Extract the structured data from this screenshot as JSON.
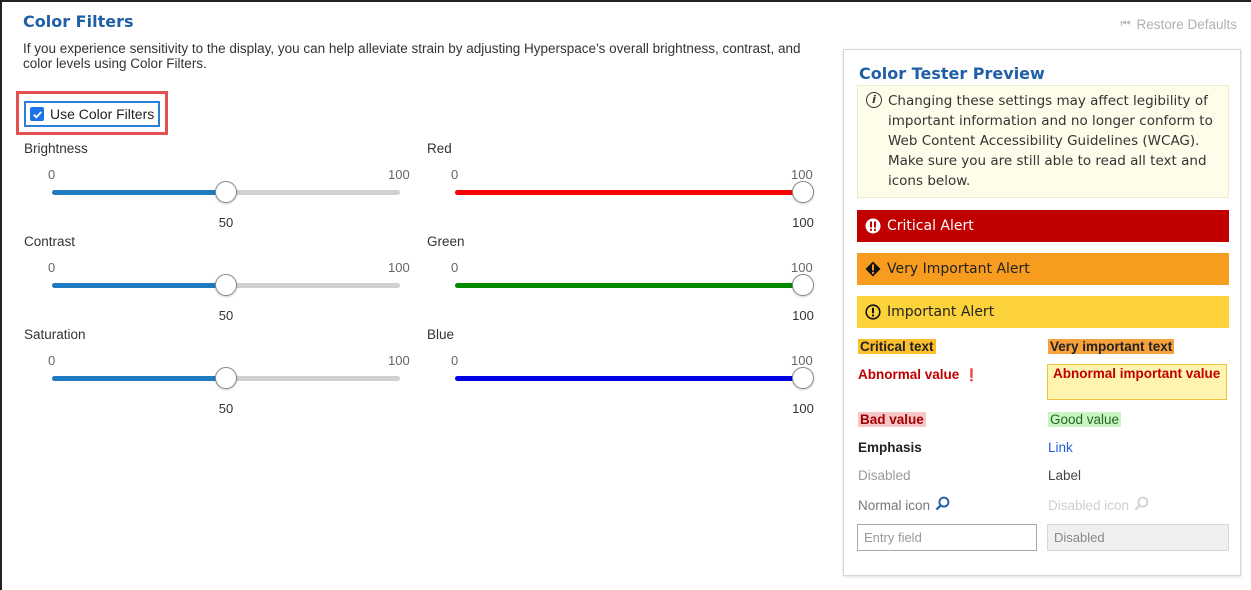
{
  "header": {
    "title": "Color Filters",
    "restore_label": "Restore Defaults"
  },
  "description": "If you experience sensitivity to the display, you can help alleviate strain by adjusting Hyperspace's overall brightness, contrast, and color levels using Color Filters.",
  "use_color_filters": {
    "label": "Use Color Filters",
    "checked": true
  },
  "sliders": [
    {
      "label": "Brightness",
      "min": "0",
      "max": "100",
      "value": "50",
      "color": "#1f7ac0"
    },
    {
      "label": "Contrast",
      "min": "0",
      "max": "100",
      "value": "50",
      "color": "#1f7ac0"
    },
    {
      "label": "Saturation",
      "min": "0",
      "max": "100",
      "value": "50",
      "color": "#1f7ac0"
    },
    {
      "label": "Red",
      "min": "0",
      "max": "100",
      "value": "100",
      "color": "#ff0000"
    },
    {
      "label": "Green",
      "min": "0",
      "max": "100",
      "value": "100",
      "color": "#008a00"
    },
    {
      "label": "Blue",
      "min": "0",
      "max": "100",
      "value": "100",
      "color": "#0000e6"
    }
  ],
  "preview": {
    "title": "Color Tester Preview",
    "warning": "Changing these settings may affect legibility of important information and no longer conform to Web Content Accessibility Guidelines (WCAG). Make sure you are still able to read all text and icons below.",
    "alerts": {
      "critical": "Critical Alert",
      "very_important": "Very Important Alert",
      "important": "Important Alert"
    },
    "samples": {
      "critical_text": "Critical text",
      "very_important_text": "Very important text",
      "abnormal_value": "Abnormal value",
      "abnormal_important_value": "Abnormal important value",
      "bad_value": "Bad value",
      "good_value": "Good value",
      "emphasis": "Emphasis",
      "link": "Link",
      "disabled": "Disabled",
      "label": "Label",
      "normal_icon": "Normal icon",
      "disabled_icon": "Disabled icon"
    },
    "entry_placeholder": "Entry field",
    "disabled_field_placeholder": "Disabled"
  }
}
